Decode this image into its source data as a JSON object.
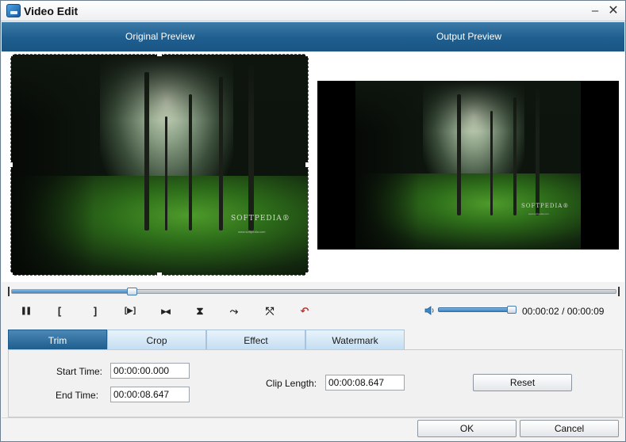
{
  "window": {
    "title": "Video Edit",
    "minimize_glyph": "–",
    "close_glyph": "✕"
  },
  "preview": {
    "original_label": "Original Preview",
    "output_label": "Output Preview",
    "watermark_brand": "SOFTPEDIA®",
    "watermark_url": "www.softpedia.com"
  },
  "playback": {
    "progress_fraction": 0.2,
    "volume_fraction": 1.0,
    "current_time": "00:00:02",
    "separator": "/",
    "total_time": "00:00:09",
    "controls": [
      {
        "name": "pause-button",
        "glyph": "❚❚"
      },
      {
        "name": "set-start-button",
        "glyph": "["
      },
      {
        "name": "set-end-button",
        "glyph": "]"
      },
      {
        "name": "next-frame-button",
        "glyph": "[▶]"
      },
      {
        "name": "split-button",
        "glyph": "▶◀"
      },
      {
        "name": "trim-marker-button",
        "glyph": "⧗"
      },
      {
        "name": "rotate-right-button",
        "glyph": "⤳"
      },
      {
        "name": "rotate-left-button",
        "glyph": "⤲"
      },
      {
        "name": "undo-button",
        "glyph": "↶"
      }
    ]
  },
  "tabs": [
    {
      "label": "Trim",
      "active": true
    },
    {
      "label": "Crop",
      "active": false
    },
    {
      "label": "Effect",
      "active": false
    },
    {
      "label": "Watermark",
      "active": false
    }
  ],
  "trim": {
    "start_label": "Start Time:",
    "start_value": "00:00:00.000",
    "end_label": "End Time:",
    "end_value": "00:00:08.647",
    "clip_length_label": "Clip Length:",
    "clip_length_value": "00:00:08.647",
    "reset_label": "Reset"
  },
  "footer": {
    "ok_label": "OK",
    "cancel_label": "Cancel"
  },
  "colors": {
    "accent": "#1f5d8d",
    "tab_inactive": "#c5def2"
  }
}
